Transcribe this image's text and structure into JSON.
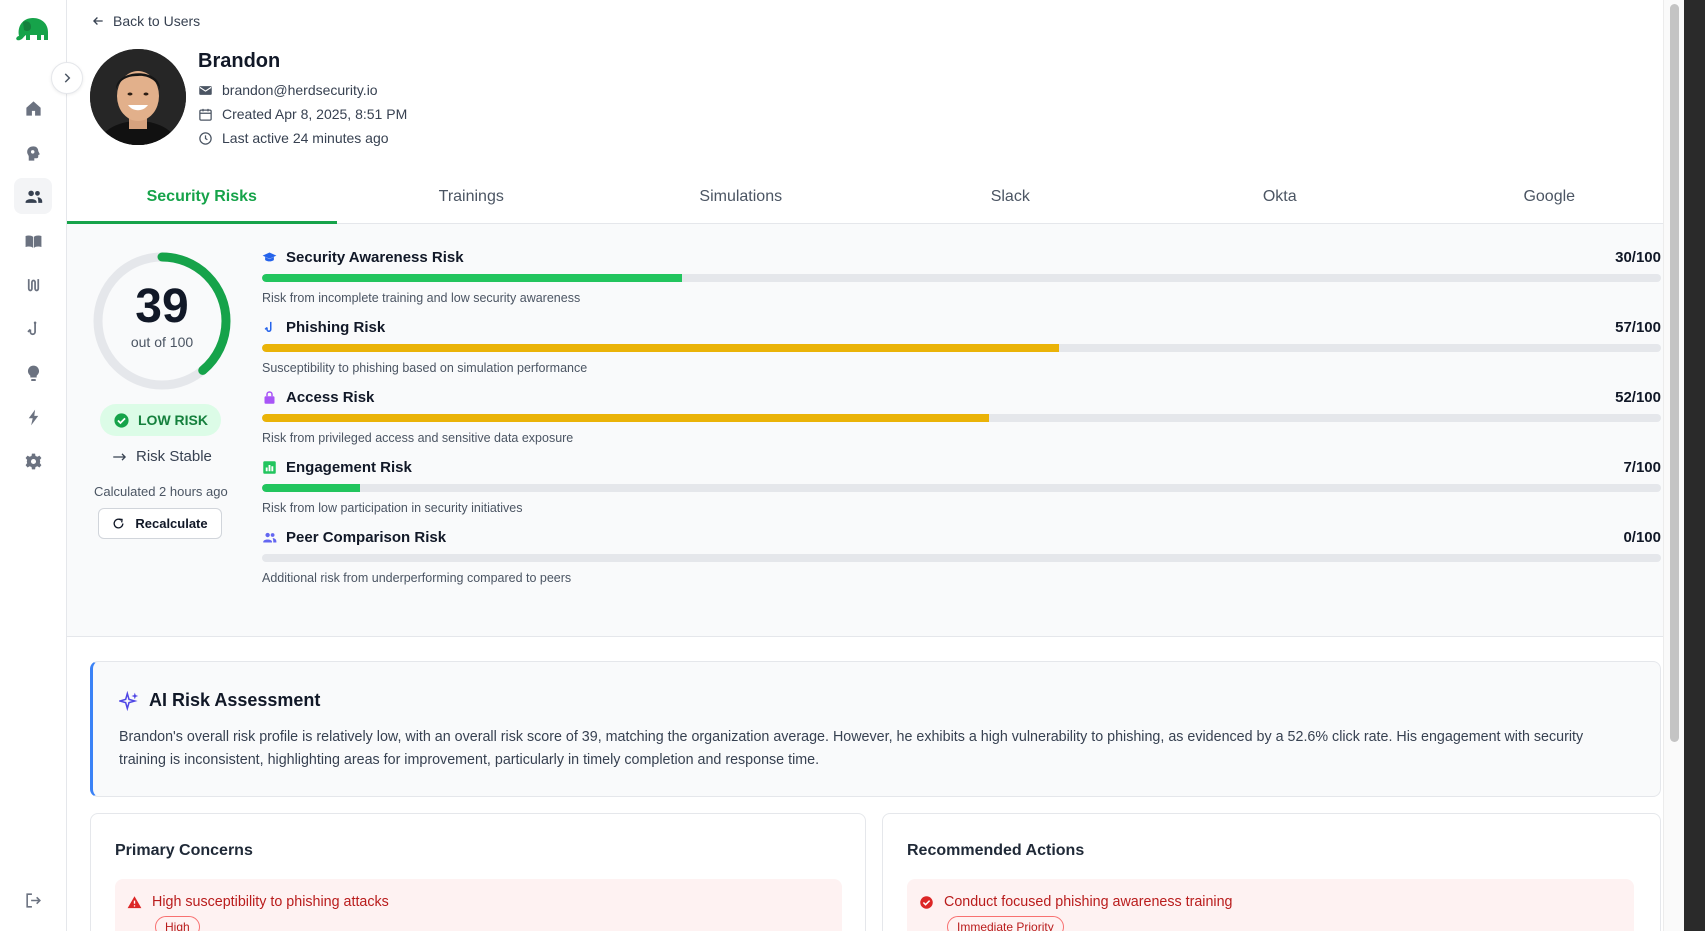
{
  "nav": {
    "items": [
      "home-icon",
      "brain-icon",
      "users-icon",
      "book-icon",
      "route-icon",
      "phishing-hook-icon",
      "lightbulb-icon",
      "bolt-icon",
      "gear-icon"
    ],
    "active": "users-icon",
    "logout": "logout-icon"
  },
  "header": {
    "back_label": "Back to Users",
    "name": "Brandon",
    "email": "brandon@herdsecurity.io",
    "created": "Created Apr 8, 2025, 8:51 PM",
    "last_active": "Last active 24 minutes ago"
  },
  "tabs": [
    {
      "label": "Security Risks",
      "active": true
    },
    {
      "label": "Trainings",
      "active": false
    },
    {
      "label": "Simulations",
      "active": false
    },
    {
      "label": "Slack",
      "active": false
    },
    {
      "label": "Okta",
      "active": false
    },
    {
      "label": "Google",
      "active": false
    }
  ],
  "score": {
    "value": "39",
    "max_label": "out of 100",
    "fraction": 0.39,
    "level": "LOW RISK",
    "trend": "Risk Stable",
    "calculated": "Calculated 2 hours ago",
    "recalc_label": "Recalculate"
  },
  "risks": [
    {
      "title": "Security Awareness Risk",
      "score": "30/100",
      "value": 30,
      "color": "#22c55e",
      "icon": "graduation-cap-icon",
      "icon_color": "#2563eb",
      "desc": "Risk from incomplete training and low security awareness"
    },
    {
      "title": "Phishing Risk",
      "score": "57/100",
      "value": 57,
      "color": "#eab308",
      "icon": "phishing-hook-icon",
      "icon_color": "#2563eb",
      "desc": "Susceptibility to phishing based on simulation performance"
    },
    {
      "title": "Access Risk",
      "score": "52/100",
      "value": 52,
      "color": "#eab308",
      "icon": "lock-icon",
      "icon_color": "#a855f7",
      "desc": "Risk from privileged access and sensitive data exposure"
    },
    {
      "title": "Engagement Risk",
      "score": "7/100",
      "value": 7,
      "color": "#22c55e",
      "icon": "bar-chart-icon",
      "icon_color": "#22c55e",
      "desc": "Risk from low participation in security initiatives"
    },
    {
      "title": "Peer Comparison Risk",
      "score": "0/100",
      "value": 0,
      "color": "#22c55e",
      "icon": "users-icon",
      "icon_color": "#6366f1",
      "desc": "Additional risk from underperforming compared to peers"
    }
  ],
  "ai": {
    "title": "AI Risk Assessment",
    "text": "Brandon's overall risk profile is relatively low, with an overall risk score of 39, matching the organization average. However, he exhibits a high vulnerability to phishing, as evidenced by a 52.6% click rate. His engagement with security training is inconsistent, highlighting areas for improvement, particularly in timely completion and response time."
  },
  "concerns": {
    "title": "Primary Concerns",
    "items": [
      {
        "text": "High susceptibility to phishing attacks",
        "badge": "High"
      }
    ]
  },
  "actions": {
    "title": "Recommended Actions",
    "items": [
      {
        "text": "Conduct focused phishing awareness training",
        "badge": "Immediate Priority"
      }
    ]
  },
  "colors": {
    "accent": "#16a34a",
    "low_risk_bg": "#dcfce7",
    "alert_red": "#b91c1c",
    "ai_border": "#3b82f6"
  }
}
